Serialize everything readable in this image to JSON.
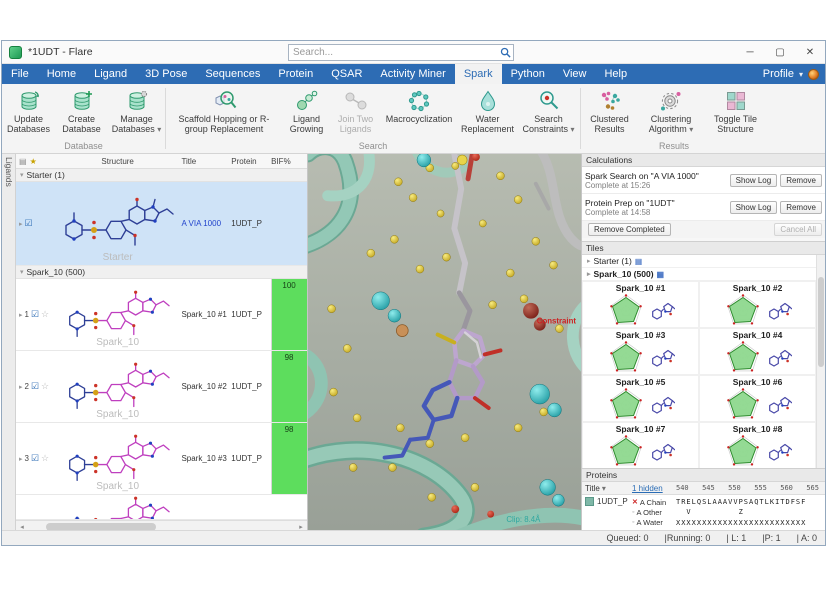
{
  "window": {
    "title": "*1UDT - Flare",
    "search_placeholder": "Search..."
  },
  "menu": {
    "tabs": [
      "File",
      "Home",
      "Ligand",
      "3D Pose",
      "Sequences",
      "Protein",
      "QSAR",
      "Activity Miner",
      "Spark",
      "Python",
      "View",
      "Help"
    ],
    "active_tab": "Spark",
    "profile": "Profile"
  },
  "ribbon": {
    "groups": [
      {
        "label": "Database",
        "buttons": [
          "Update Databases",
          "Create Database",
          "Manage Databases"
        ]
      },
      {
        "label": "Search",
        "buttons": [
          "Scaffold Hopping or R-group Replacement",
          "Ligand Growing",
          "Join Two Ligands",
          "Macrocyclization",
          "Water Replacement",
          "Search Constraints"
        ]
      },
      {
        "label": "Results",
        "buttons": [
          "Clustered Results",
          "Clustering Algorithm",
          "Toggle Tile Structure"
        ]
      }
    ]
  },
  "ligands": {
    "tab_label": "Ligands",
    "columns": {
      "structure": "Structure",
      "title": "Title",
      "protein": "Protein",
      "bif": "BIF%"
    },
    "group_starter": "Starter (1)",
    "group_spark": "Spark_10 (500)",
    "starter": {
      "title": "A VIA 1000",
      "protein": "1UDT_P",
      "watermark": "Starter"
    },
    "rows": [
      {
        "num": "1",
        "title": "Spark_10 #1",
        "protein": "1UDT_P",
        "bif": "100",
        "watermark": "Spark_10"
      },
      {
        "num": "2",
        "title": "Spark_10 #2",
        "protein": "1UDT_P",
        "bif": "98",
        "watermark": "Spark_10"
      },
      {
        "num": "3",
        "title": "Spark_10 #3",
        "protein": "1UDT_P",
        "bif": "98",
        "watermark": "Spark_10"
      }
    ]
  },
  "viewer": {
    "constraint_label": "Constraint",
    "clip_label": "Clip: 8.4Å"
  },
  "calc": {
    "title": "Calculations",
    "items": [
      {
        "name": "Spark Search on \"A VIA 1000\"",
        "status": "Complete at 15:26",
        "log_btn": "Show Log",
        "remove_btn": "Remove"
      },
      {
        "name": "Protein Prep on \"1UDT\"",
        "status": "Complete at 14:58",
        "log_btn": "Show Log",
        "remove_btn": "Remove"
      }
    ],
    "remove_completed": "Remove Completed",
    "cancel_all": "Cancel All"
  },
  "tiles": {
    "title": "Tiles",
    "tree": [
      {
        "label": "Starter (1)"
      },
      {
        "label": "Spark_10 (500)"
      }
    ],
    "items": [
      {
        "label": "Spark_10 #1"
      },
      {
        "label": "Spark_10 #2"
      },
      {
        "label": "Spark_10 #3"
      },
      {
        "label": "Spark_10 #4"
      },
      {
        "label": "Spark_10 #5"
      },
      {
        "label": "Spark_10 #6"
      },
      {
        "label": "Spark_10 #7"
      },
      {
        "label": "Spark_10 #8"
      }
    ]
  },
  "proteins": {
    "title": "Proteins",
    "title_col": "Title",
    "hidden_link": "1 hidden",
    "ruler": [
      "540",
      "545",
      "550",
      "555",
      "560",
      "565"
    ],
    "row": {
      "name": "1UDT_P",
      "chains": [
        {
          "label": "A Chain"
        },
        {
          "label": "A Other"
        },
        {
          "label": "A Water"
        }
      ],
      "seq": [
        "TRELQSLAAAVVPSAQTLKITDFSF",
        "  V         Z",
        "XXXXXXXXXXXXXXXXXXXXXXXXX"
      ]
    }
  },
  "status": {
    "items": [
      "Queued: 0",
      "|Running: 0",
      "| L: 1",
      "|P: 1",
      "| A: 0"
    ]
  }
}
